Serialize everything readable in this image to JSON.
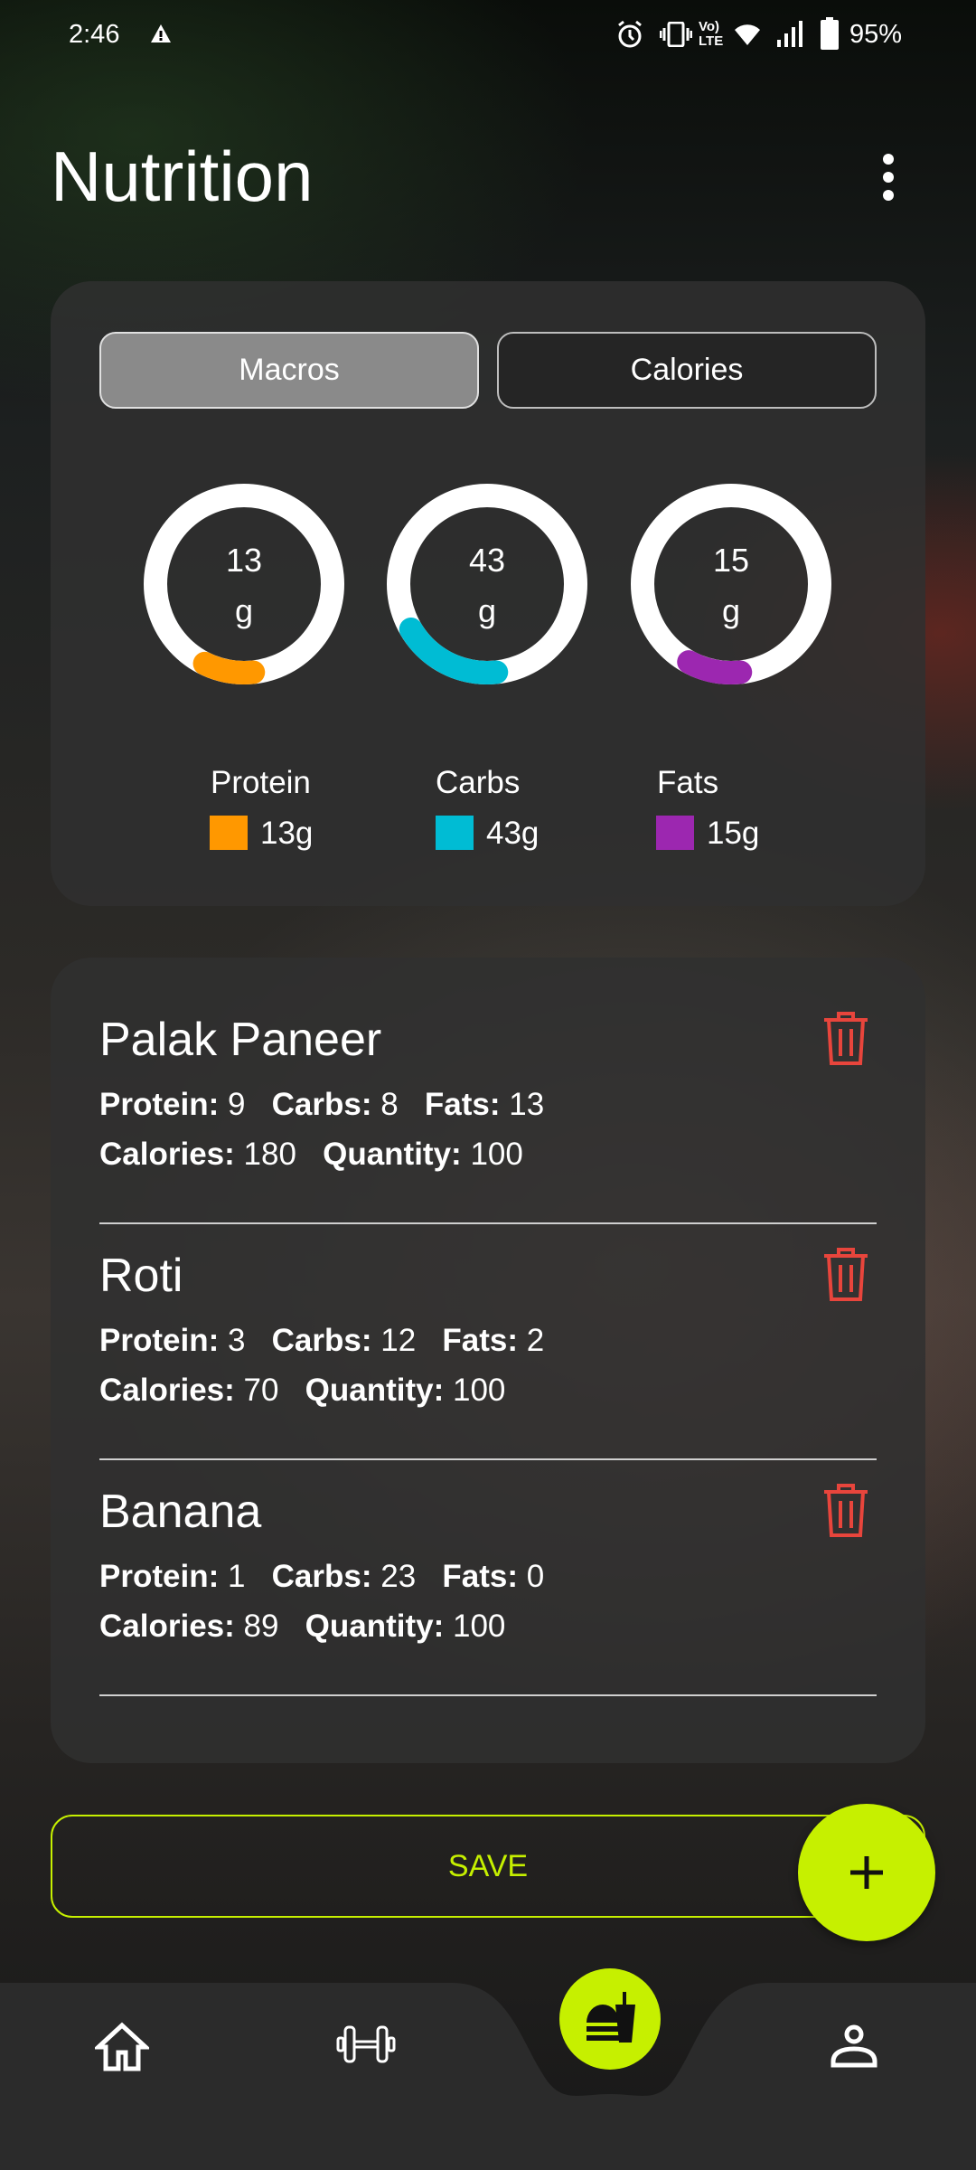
{
  "status_bar": {
    "time": "2:46",
    "battery": "95%",
    "icons": [
      "warning-icon",
      "alarm-icon",
      "vibrate-icon",
      "volte-icon",
      "wifi-icon",
      "signal-icon",
      "battery-icon"
    ]
  },
  "header": {
    "title": "Nutrition",
    "menu_icon": "more-vert-icon"
  },
  "tabs": [
    {
      "label": "Macros",
      "selected": true
    },
    {
      "label": "Calories",
      "selected": false
    }
  ],
  "rings": [
    {
      "value": "13",
      "unit": "g",
      "color": "#ff9800"
    },
    {
      "value": "43",
      "unit": "g",
      "color": "#00bcd4"
    },
    {
      "value": "15",
      "unit": "g",
      "color": "#9c27b0"
    }
  ],
  "legend": [
    {
      "label": "Protein",
      "value": "13g",
      "color": "#ff9800"
    },
    {
      "label": "Carbs",
      "value": "43g",
      "color": "#00bcd4"
    },
    {
      "label": "Fats",
      "value": "15g",
      "color": "#9c27b0"
    }
  ],
  "labels": {
    "protein": "Protein:",
    "carbs": "Carbs:",
    "fats": "Fats:",
    "calories": "Calories:",
    "quantity": "Quantity:"
  },
  "foods": [
    {
      "name": "Palak Paneer",
      "protein": "9",
      "carbs": "8",
      "fats": "13",
      "calories": "180",
      "quantity": "100"
    },
    {
      "name": "Roti",
      "protein": "3",
      "carbs": "12",
      "fats": "2",
      "calories": "70",
      "quantity": "100"
    },
    {
      "name": "Banana",
      "protein": "1",
      "carbs": "23",
      "fats": "0",
      "calories": "89",
      "quantity": "100"
    }
  ],
  "save_label": "SAVE",
  "accent": "#c6f000",
  "delete_color": "#e8453c",
  "nav": [
    {
      "icon": "home-icon"
    },
    {
      "icon": "dumbbell-icon"
    },
    {
      "icon": "fastfood-icon",
      "active": true
    },
    {
      "icon": "person-icon"
    }
  ]
}
